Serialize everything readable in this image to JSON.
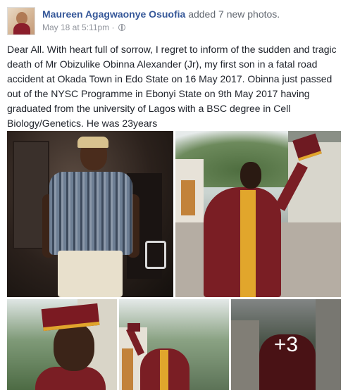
{
  "post": {
    "author": "Maureen Agagwaonye Osuofia",
    "action": "added 7 new photos.",
    "timestamp": "May 18 at 5:11pm",
    "separator": "·",
    "privacy_icon": "globe-icon",
    "message": "Dear All. With heart full of sorrow, I regret to inform of the sudden and tragic death of Mr Obizulike Obinna Alexander (Jr), my first son in a fatal road accident at Okada Town in Edo State on 16 May 2017. Obinna just passed out of the NYSC Programme in Ebonyi State on 9th May 2017 having graduated from the university of Lagos with a BSC degree in Cell Biology/Genetics. He was 23years",
    "more_photos_label": "+3"
  },
  "colors": {
    "author_link": "#365899",
    "meta_text": "#90949c",
    "body_text": "#1d2129",
    "gown": "#7a1e24",
    "sash": "#e1a62c"
  }
}
